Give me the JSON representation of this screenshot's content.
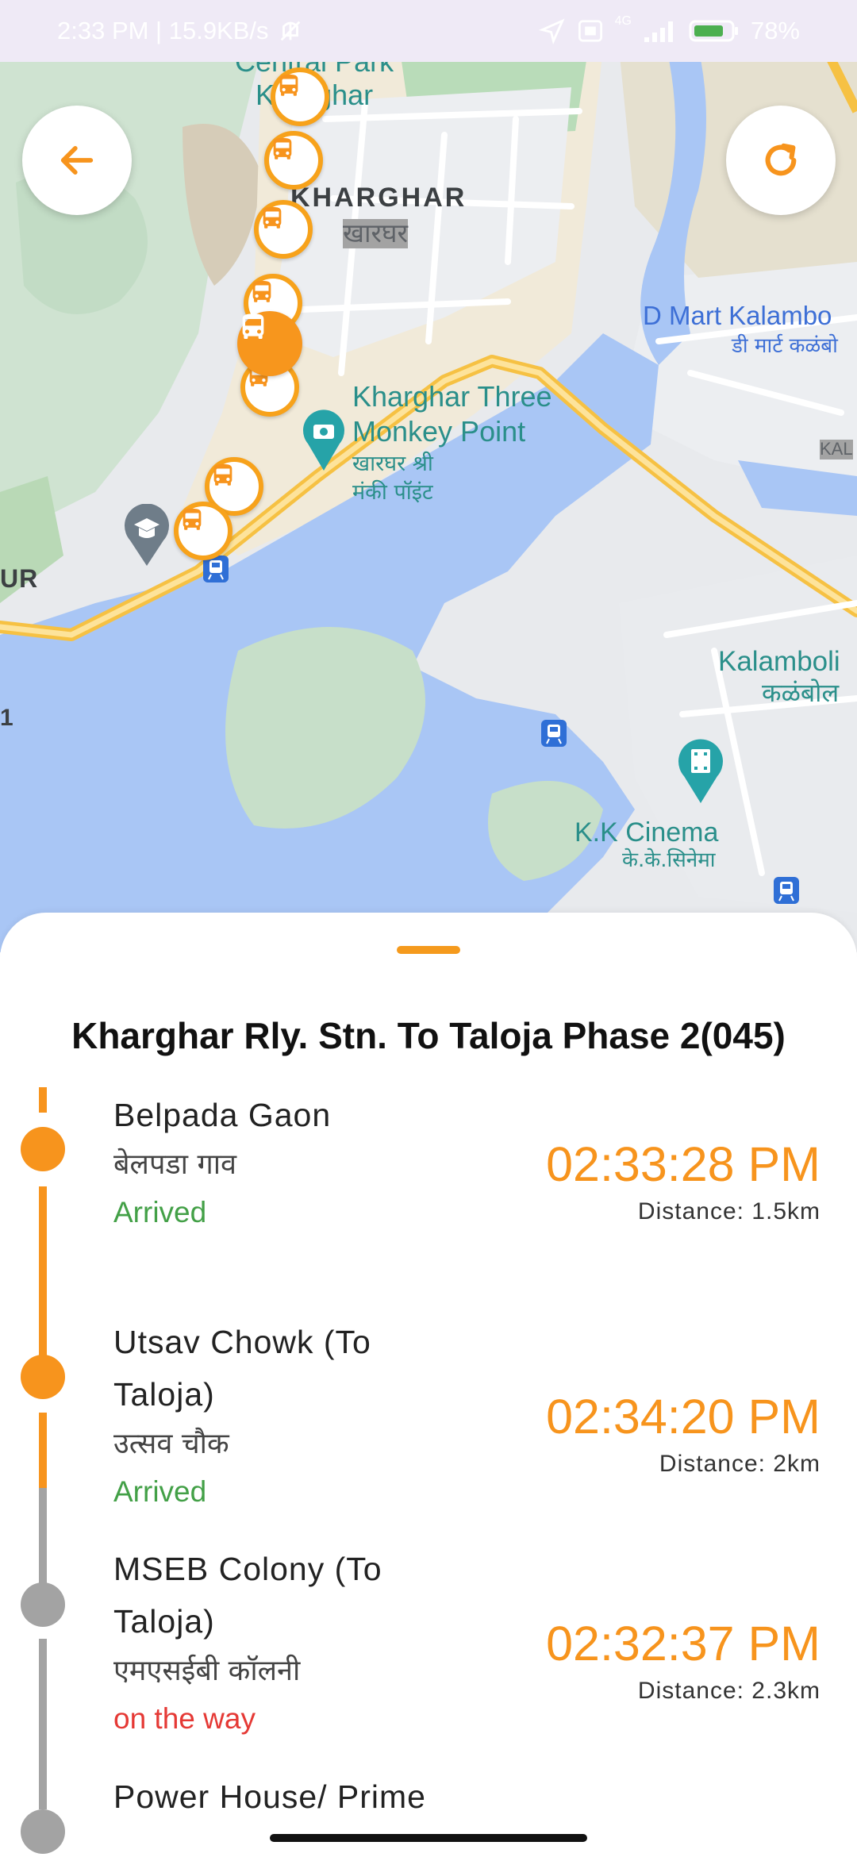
{
  "status_bar": {
    "left_text": "2:33 PM | 15.9KB/s",
    "network": "4G",
    "battery": "78%"
  },
  "map": {
    "labels": {
      "central_park": "Central Park",
      "kharghar_small": "Kharghar",
      "kharghar_en": "KHARGHAR",
      "kharghar_local": "खारघर",
      "monkey_en_1": "Kharghar Three",
      "monkey_en_2": "Monkey Point",
      "monkey_local_1": "खारघर श्री",
      "monkey_local_2": "मंकी पॉइंट",
      "dmart_en": "D Mart Kalambo",
      "dmart_local": "डी मार्ट कळंबो",
      "kalamboli_en": "Kalamboli",
      "kalamboli_local": "कळंबोल",
      "kk_en": "K.K Cinema",
      "kk_local": "के.के.सिनेमा",
      "kal_small": "KAL",
      "ur_edge": "UR",
      "one_edge": "1"
    }
  },
  "buttons": {
    "back_icon": "arrow-left-icon",
    "refresh_icon": "refresh-icon"
  },
  "colors": {
    "accent": "#f7941d",
    "arrived": "#43a047",
    "on_the_way": "#e53935",
    "inactive": "#a3a3a3"
  },
  "route": {
    "title": "Kharghar Rly. Stn. To Taloja Phase 2(045)",
    "stops": [
      {
        "name": "Belpada Gaon",
        "local_name": "बेलपडा गाव",
        "status": "Arrived",
        "time": "02:33:28 PM",
        "distance": "Distance: 1.5km"
      },
      {
        "name_line1": "Utsav Chowk (To",
        "name_line2": "Taloja)",
        "local_name": "उत्सव चौक",
        "status": "Arrived",
        "time": "02:34:20 PM",
        "distance": "Distance: 2km"
      },
      {
        "name_line1": "MSEB Colony (To",
        "name_line2": "Taloja)",
        "local_name": "एमएसईबी कॉलनी",
        "status": "on the way",
        "time": "02:32:37 PM",
        "distance": "Distance: 2.3km"
      },
      {
        "name": "Power House/ Prime"
      }
    ]
  }
}
